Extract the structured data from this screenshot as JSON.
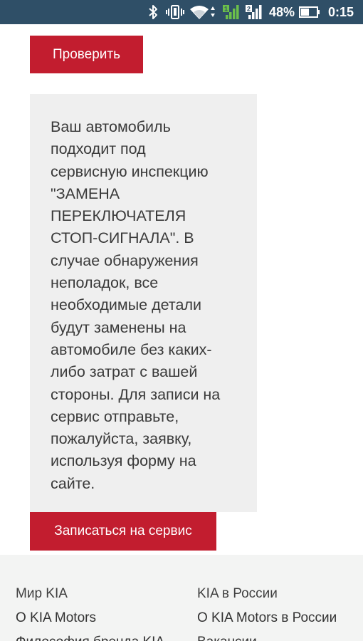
{
  "status_bar": {
    "icons": [
      "bluetooth-icon",
      "vibrate-icon",
      "wifi-icon",
      "sim1-signal-icon",
      "sim2-signal-icon",
      "battery-icon"
    ],
    "battery_percent": "48%",
    "time": "0:15",
    "background_color": "#2f4f67"
  },
  "check_button": {
    "label": "Проверить"
  },
  "message": {
    "text": "Ваш автомобиль\nподходит под\nсервисную инспекцию\n\"ЗАМЕНА\nПЕРЕКЛЮЧАТЕЛЯ\nСТОП-СИГНАЛА\". В\nслучае обнаружения\nнеполадок, все\nнеобходимые детали\nбудут заменены на\nавтомобиле без каких-\nлибо затрат с вашей\nстороны. Для записи на\nсервис отправьте,\nпожалуйста, заявку,\nиспользуя форму на\nсайте."
  },
  "service_button": {
    "label": "Записаться на сервис"
  },
  "footer": {
    "columns": [
      {
        "heading": "Мир KIA",
        "links": [
          "О KIA Motors",
          "Философия бренда KIA"
        ]
      },
      {
        "heading": "KIA в России",
        "links": [
          "О KIA Motors в России",
          "Вакансии"
        ]
      }
    ]
  },
  "colors": {
    "accent_red": "#c21d2f",
    "message_background": "#efefef",
    "footer_background": "#f3f4f3"
  }
}
